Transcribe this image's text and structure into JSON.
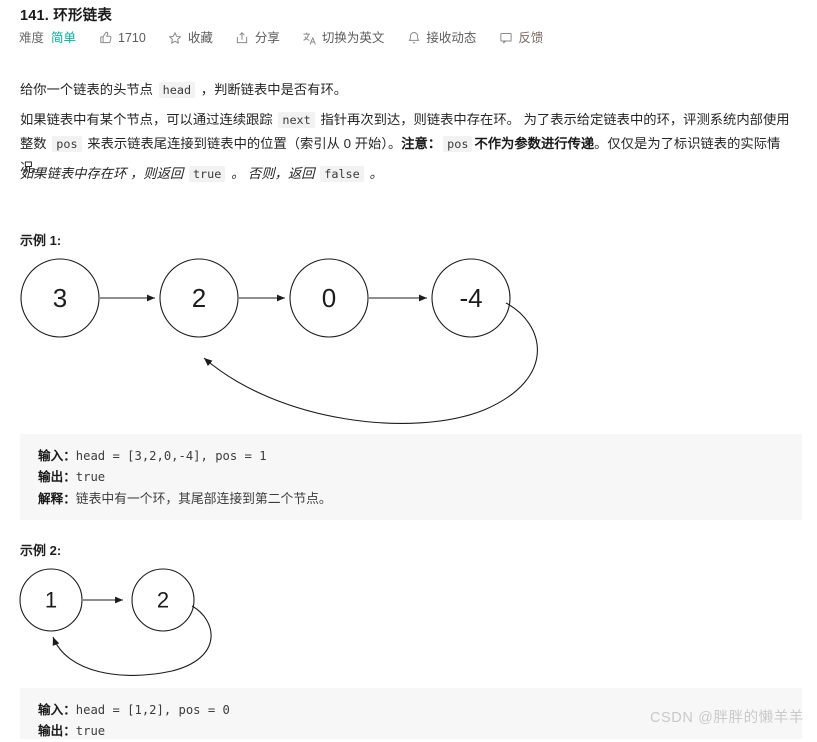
{
  "header": {
    "title": "141. 环形链表",
    "difficulty_label": "难度",
    "difficulty_value": "简单",
    "difficulty_color": "#00af9b",
    "actions": [
      {
        "icon": "thumbs-up-icon",
        "label": "1710"
      },
      {
        "icon": "star-icon",
        "label": "收藏"
      },
      {
        "icon": "share-icon",
        "label": "分享"
      },
      {
        "icon": "translate-icon",
        "label": "切换为英文"
      },
      {
        "icon": "bell-icon",
        "label": "接收动态"
      },
      {
        "icon": "feedback-icon",
        "label": "反馈"
      }
    ]
  },
  "description": {
    "p1_a": "给你一个链表的头节点 ",
    "p1_code": "head",
    "p1_b": " ，判断链表中是否有环。",
    "p2_a": "如果链表中有某个节点，可以通过连续跟踪 ",
    "p2_code1": "next",
    "p2_b": " 指针再次到达，则链表中存在环。 为了表示给定链表中的环，评测系统内部使用整数 ",
    "p2_code2": "pos",
    "p2_c": " 来表示链表尾连接到链表中的位置（索引从 0 开始）。",
    "p2_note": "注意：",
    "p2_code3": "pos",
    "p2_bold": "不作为参数进行传递",
    "p2_d": "。仅仅是为了标识链表的实际情况。",
    "p3_a": "如果链表中存在环 ，则返回 ",
    "p3_code1": "true",
    "p3_b": " 。 否则，返回 ",
    "p3_code2": "false",
    "p3_c": " 。"
  },
  "examples": [
    {
      "heading": "示例 1:",
      "diagram": {
        "nodes": [
          "3",
          "2",
          "0",
          "-4"
        ],
        "cycle_from": 3,
        "cycle_to": 1
      },
      "input_key": "输入：",
      "input_value": "head = [3,2,0,-4], pos = 1",
      "output_key": "输出：",
      "output_value": "true",
      "explain_key": "解释：",
      "explain_value": "链表中有一个环，其尾部连接到第二个节点。"
    },
    {
      "heading": "示例 2:",
      "diagram": {
        "nodes": [
          "1",
          "2"
        ],
        "cycle_from": 1,
        "cycle_to": 0
      },
      "input_key": "输入：",
      "input_value": "head = [1,2], pos = 0",
      "output_key": "输出：",
      "output_value": "true"
    }
  ],
  "watermark": "CSDN @胖胖的懒羊羊"
}
